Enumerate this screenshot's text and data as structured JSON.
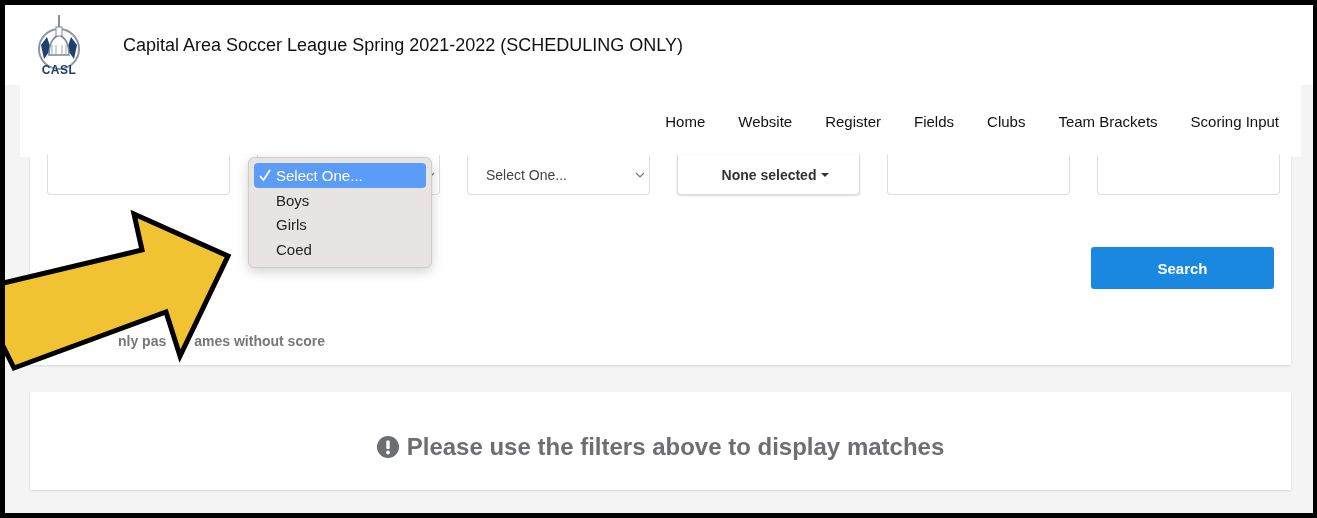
{
  "header": {
    "logo_text": "CASL",
    "title": "Capital Area Soccer League Spring 2021-2022 (SCHEDULING ONLY)"
  },
  "nav": [
    {
      "label": "Home"
    },
    {
      "label": "Website"
    },
    {
      "label": "Register"
    },
    {
      "label": "Fields"
    },
    {
      "label": "Clubs"
    },
    {
      "label": "Team Brackets"
    },
    {
      "label": "Scoring Input"
    }
  ],
  "filters": [
    {
      "kind": "input"
    },
    {
      "kind": "select"
    },
    {
      "kind": "select",
      "value": "Select One..."
    },
    {
      "kind": "multiselect",
      "value": "None selected"
    },
    {
      "kind": "input"
    },
    {
      "kind": "input"
    }
  ],
  "dropdown": {
    "options": [
      {
        "label": "Select One...",
        "selected": true
      },
      {
        "label": "Boys",
        "selected": false
      },
      {
        "label": "Girls",
        "selected": false
      },
      {
        "label": "Coed",
        "selected": false
      }
    ]
  },
  "search_button": "Search",
  "checkbox_label_parts": [
    "nly pas",
    "ames without score"
  ],
  "message": "Please use the filters above to display matches"
}
